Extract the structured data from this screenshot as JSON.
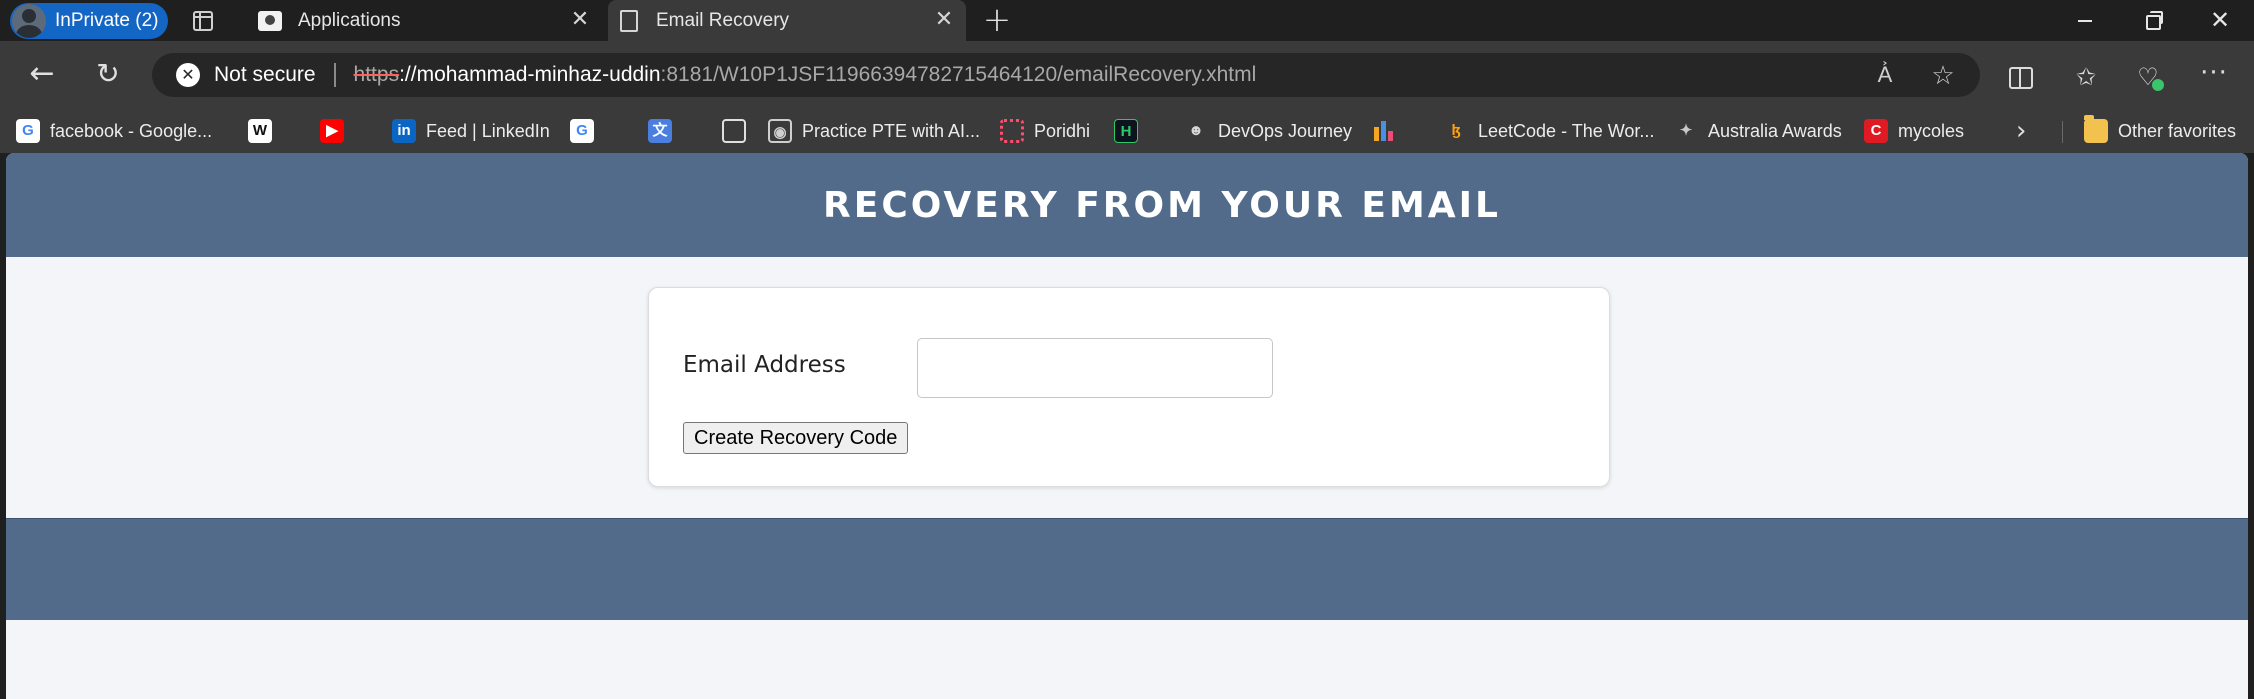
{
  "browser": {
    "inprivate_label": "InPrivate (2)",
    "tabs": [
      {
        "title": "Applications",
        "active": false
      },
      {
        "title": "Email Recovery",
        "active": true
      }
    ],
    "security_label": "Not secure",
    "url": {
      "scheme": "https",
      "host": "://mohammad-minhaz-uddin",
      "rest": ":8181/W10P1JSF11966394782715464120/emailRecovery.xhtml"
    },
    "bookmarks": [
      {
        "icon": "google-icon",
        "label": "facebook - Google..."
      },
      {
        "icon": "wikipedia-icon",
        "label": ""
      },
      {
        "icon": "youtube-icon",
        "label": ""
      },
      {
        "icon": "linkedin-icon",
        "label": "Feed | LinkedIn"
      },
      {
        "icon": "google-icon",
        "label": ""
      },
      {
        "icon": "google-translate-icon",
        "label": ""
      },
      {
        "icon": "document-icon",
        "label": ""
      },
      {
        "icon": "pte-icon",
        "label": "Practice PTE with AI..."
      },
      {
        "icon": "poridhi-icon",
        "label": "Poridhi"
      },
      {
        "icon": "hackerrank-icon",
        "label": ""
      },
      {
        "icon": "devops-icon",
        "label": "DevOps Journey"
      },
      {
        "icon": "chart-icon",
        "label": ""
      },
      {
        "icon": "leetcode-icon",
        "label": "LeetCode - The Wor..."
      },
      {
        "icon": "australia-awards-icon",
        "label": "Australia Awards"
      },
      {
        "icon": "coles-icon",
        "label": "mycoles"
      }
    ],
    "other_favorites": "Other favorites"
  },
  "page": {
    "title": "RECOVERY FROM YOUR EMAIL",
    "form": {
      "email_label": "Email Address",
      "email_value": "",
      "submit_label": "Create Recovery Code"
    }
  },
  "colors": {
    "header_bg": "#526b8a",
    "page_bg": "#f3f5f8",
    "inprivate_bg": "#1466c4"
  }
}
